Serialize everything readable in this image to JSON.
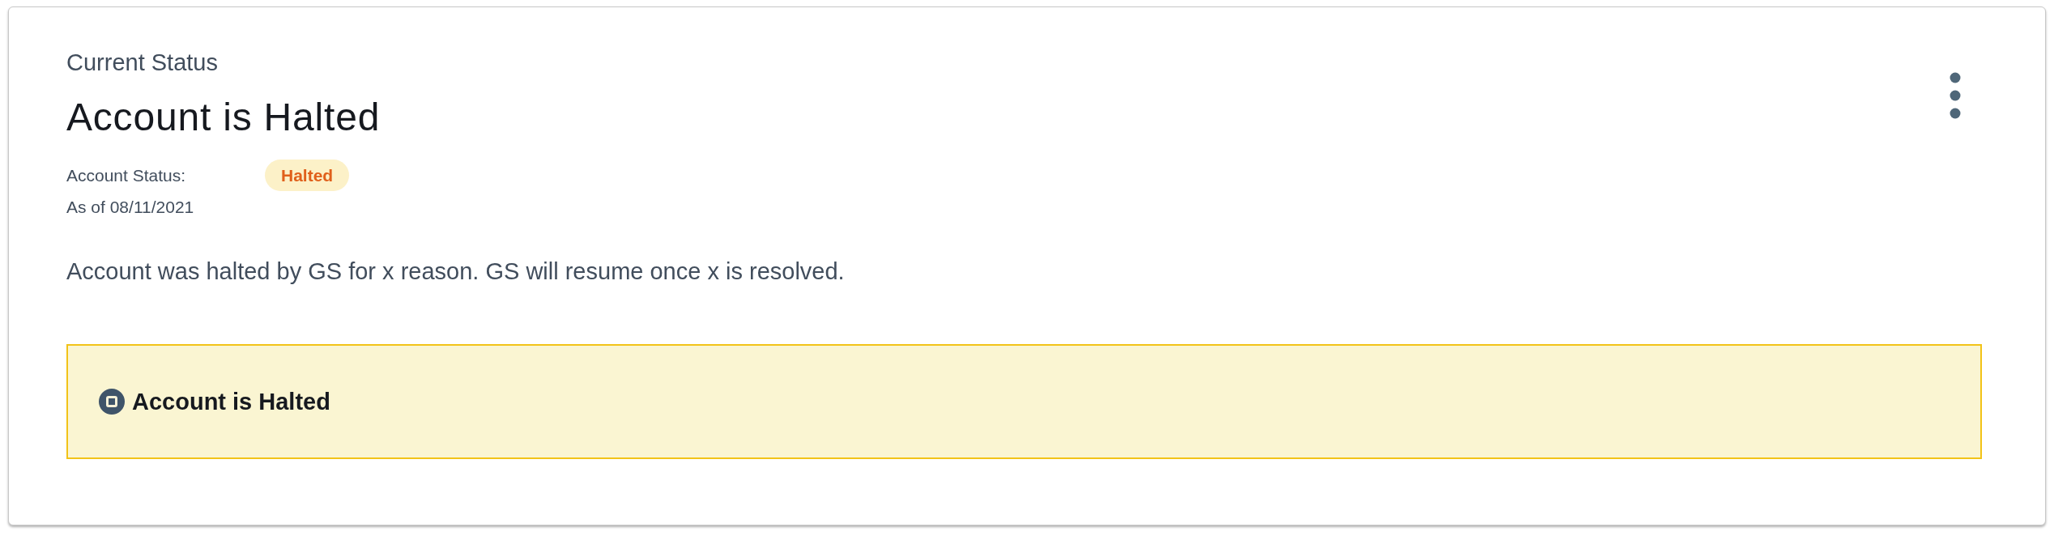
{
  "card": {
    "eyebrow": "Current Status",
    "title": "Account is Halted",
    "status": {
      "label": "Account Status:",
      "badge": "Halted"
    },
    "as_of": "As of 08/11/2021",
    "description": "Account was halted by GS for x reason. GS will resume once x is resolved.",
    "alert": {
      "text": "Account is Halted"
    }
  }
}
